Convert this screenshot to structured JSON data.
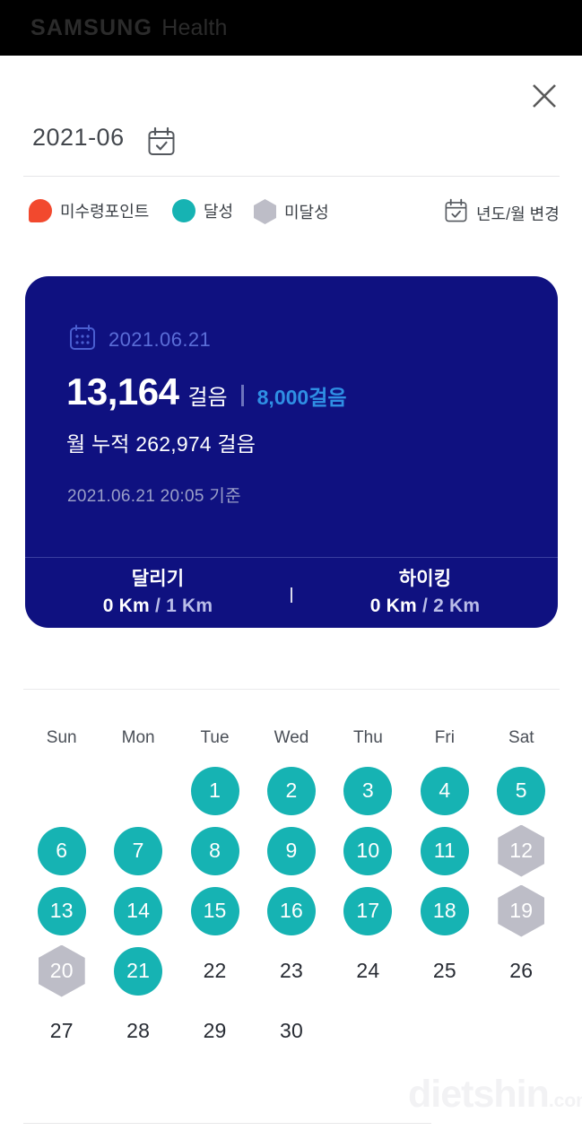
{
  "appbar": {
    "brand": "SAMSUNG",
    "sub": "Health",
    "close_icon": "close-icon"
  },
  "month_selector": {
    "value": "2021-06",
    "icon": "calendar-check-icon"
  },
  "legend": {
    "items": [
      {
        "label": "미수령포인트",
        "marker": "red-circle",
        "color": "#f2492e"
      },
      {
        "label": "달성",
        "marker": "teal-circle",
        "color": "#16b3b3"
      },
      {
        "label": "미달성",
        "marker": "gray-hexagon",
        "color": "#bdbdc7"
      }
    ],
    "change_action": {
      "label": "년도/월 변경",
      "icon": "calendar-check-icon"
    }
  },
  "card": {
    "date": "2021.06.21",
    "date_icon": "calendar-grid-icon",
    "steps_value": "13,164",
    "steps_unit": "걸음",
    "steps_goal": "8,000걸음",
    "month_total": "월 누적 262,974 걸음",
    "as_of": "2021.06.21 20:05 기준",
    "stats": [
      {
        "title": "달리기",
        "current": "0 Km",
        "separator": "/",
        "goal": "1 Km"
      },
      {
        "title": "하이킹",
        "current": "0 Km",
        "separator": "/",
        "goal": "2 Km"
      }
    ],
    "bg_color": "#0f1180",
    "goal_color": "#2f8fe4"
  },
  "calendar": {
    "day_headers": [
      "Sun",
      "Mon",
      "Tue",
      "Wed",
      "Thu",
      "Fri",
      "Sat"
    ],
    "weeks": [
      [
        {
          "day": "",
          "state": "empty"
        },
        {
          "day": "",
          "state": "empty"
        },
        {
          "day": "1",
          "state": "achieved"
        },
        {
          "day": "2",
          "state": "achieved"
        },
        {
          "day": "3",
          "state": "achieved"
        },
        {
          "day": "4",
          "state": "achieved"
        },
        {
          "day": "5",
          "state": "achieved"
        }
      ],
      [
        {
          "day": "6",
          "state": "achieved"
        },
        {
          "day": "7",
          "state": "achieved"
        },
        {
          "day": "8",
          "state": "achieved"
        },
        {
          "day": "9",
          "state": "achieved"
        },
        {
          "day": "10",
          "state": "achieved"
        },
        {
          "day": "11",
          "state": "achieved"
        },
        {
          "day": "12",
          "state": "missed"
        }
      ],
      [
        {
          "day": "13",
          "state": "achieved"
        },
        {
          "day": "14",
          "state": "achieved"
        },
        {
          "day": "15",
          "state": "achieved"
        },
        {
          "day": "16",
          "state": "achieved"
        },
        {
          "day": "17",
          "state": "achieved"
        },
        {
          "day": "18",
          "state": "achieved"
        },
        {
          "day": "19",
          "state": "missed"
        }
      ],
      [
        {
          "day": "20",
          "state": "missed"
        },
        {
          "day": "21",
          "state": "achieved"
        },
        {
          "day": "22",
          "state": "plain"
        },
        {
          "day": "23",
          "state": "plain"
        },
        {
          "day": "24",
          "state": "plain"
        },
        {
          "day": "25",
          "state": "plain"
        },
        {
          "day": "26",
          "state": "plain"
        }
      ],
      [
        {
          "day": "27",
          "state": "plain"
        },
        {
          "day": "28",
          "state": "plain"
        },
        {
          "day": "29",
          "state": "plain"
        },
        {
          "day": "30",
          "state": "plain"
        },
        {
          "day": "",
          "state": "empty"
        },
        {
          "day": "",
          "state": "empty"
        },
        {
          "day": "",
          "state": "empty"
        }
      ]
    ]
  },
  "watermark": {
    "name": "dietshin",
    "tld": ".com"
  }
}
